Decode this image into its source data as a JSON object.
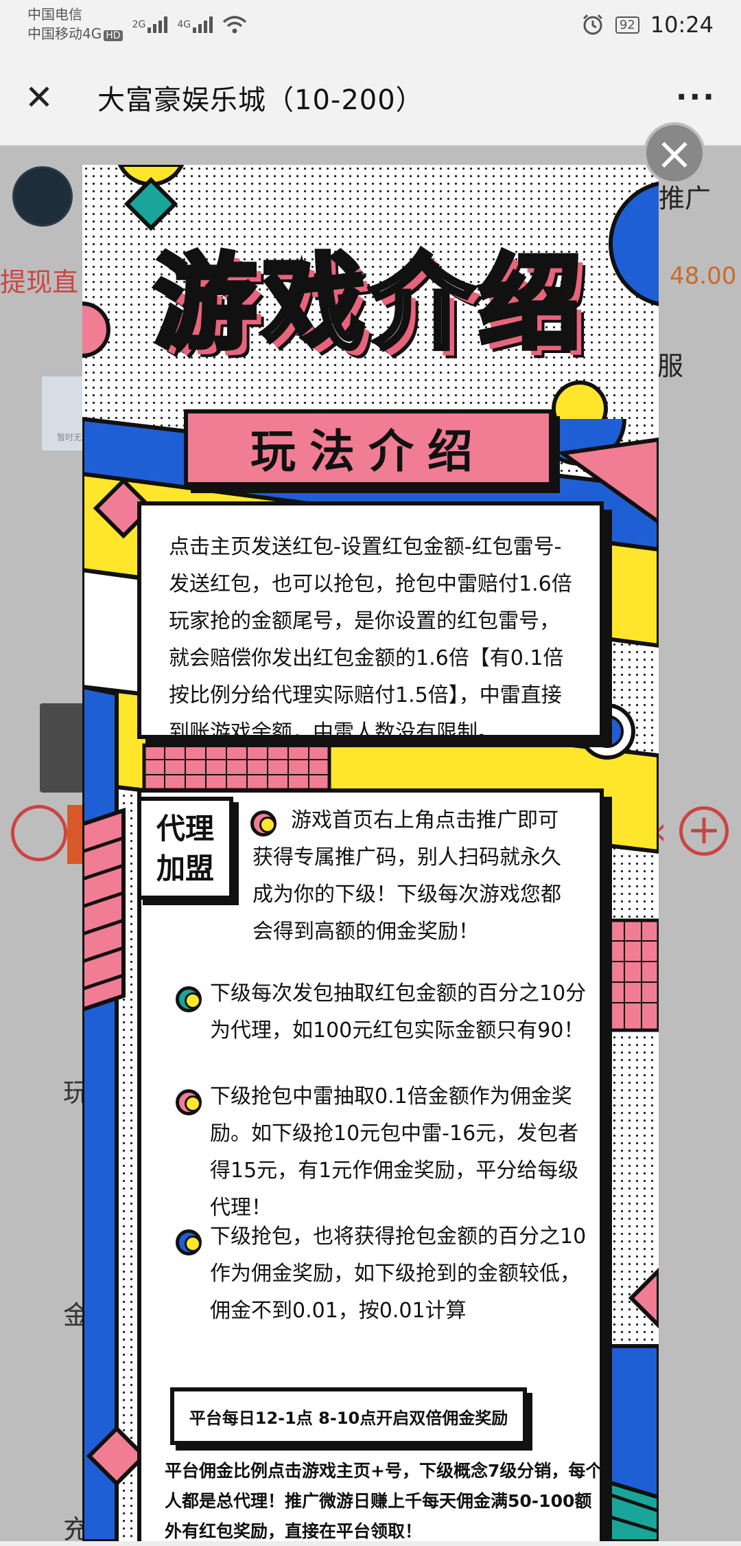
{
  "status_bar": {
    "carrier1": "中国电信",
    "carrier2": "中国移动4G",
    "hd": "HD",
    "net1": "2G",
    "net2": "4G",
    "battery": "92",
    "time": "10:24"
  },
  "title_bar": {
    "close_icon": "close-icon",
    "title": "大富豪娱乐城（10-200）",
    "more": "···"
  },
  "background": {
    "promo_label": "推广",
    "left_red_text": "提现直",
    "price": "48.00",
    "service_label": "服",
    "side_labels": [
      "玩",
      "金",
      "充"
    ],
    "thumb_text": "暂时无"
  },
  "poster": {
    "main_title": "游戏介绍",
    "section_banner": "玩法介绍",
    "rules_text": "点击主页发送红包-设置红包金额-红包雷号-发送红包，也可以抢包，抢包中雷赔付1.6倍玩家抢的金额尾号，是你设置的红包雷号，就会赔偿你发出红包金额的1.6倍【有0.1倍按比例分给代理实际赔付1.5倍】，中雷直接到账游戏余额，中雷人数没有限制。",
    "agent_tag_line1": "代理",
    "agent_tag_line2": "加盟",
    "agent_intro": "游戏首页右上角点击推广即可获得专属推广码，别人扫码就永久成为你的下级！下级每次游戏您都会得到高额的佣金奖励！",
    "bullet1": "下级每次发包抽取红包金额的百分之10分为代理，如100元红包实际金额只有90！",
    "bullet2": "下级抢包中雷抽取0.1倍金额作为佣金奖励。如下级抢10元包中雷-16元，发包者得15元，有1元作佣金奖励，平分给每级代理！",
    "bullet3": "下级抢包，也将获得抢包金额的百分之10作为佣金奖励，如下级抢到的金额较低，佣金不到0.01，按0.01计算",
    "double_reward": "平台每日12-1点 8-10点开启双倍佣金奖励",
    "footer_text": "平台佣金比例点击游戏主页+号，下级概念7级分销，每个人都是总代理！推广微游日赚上千每天佣金满50-100额外有红包奖励，直接在平台领取！"
  },
  "colors": {
    "pink": "#f07d93",
    "yellow": "#ffe62a",
    "blue": "#1f5fd6",
    "teal": "#1aa59a",
    "dim_overlay": "#bdbdbd"
  }
}
